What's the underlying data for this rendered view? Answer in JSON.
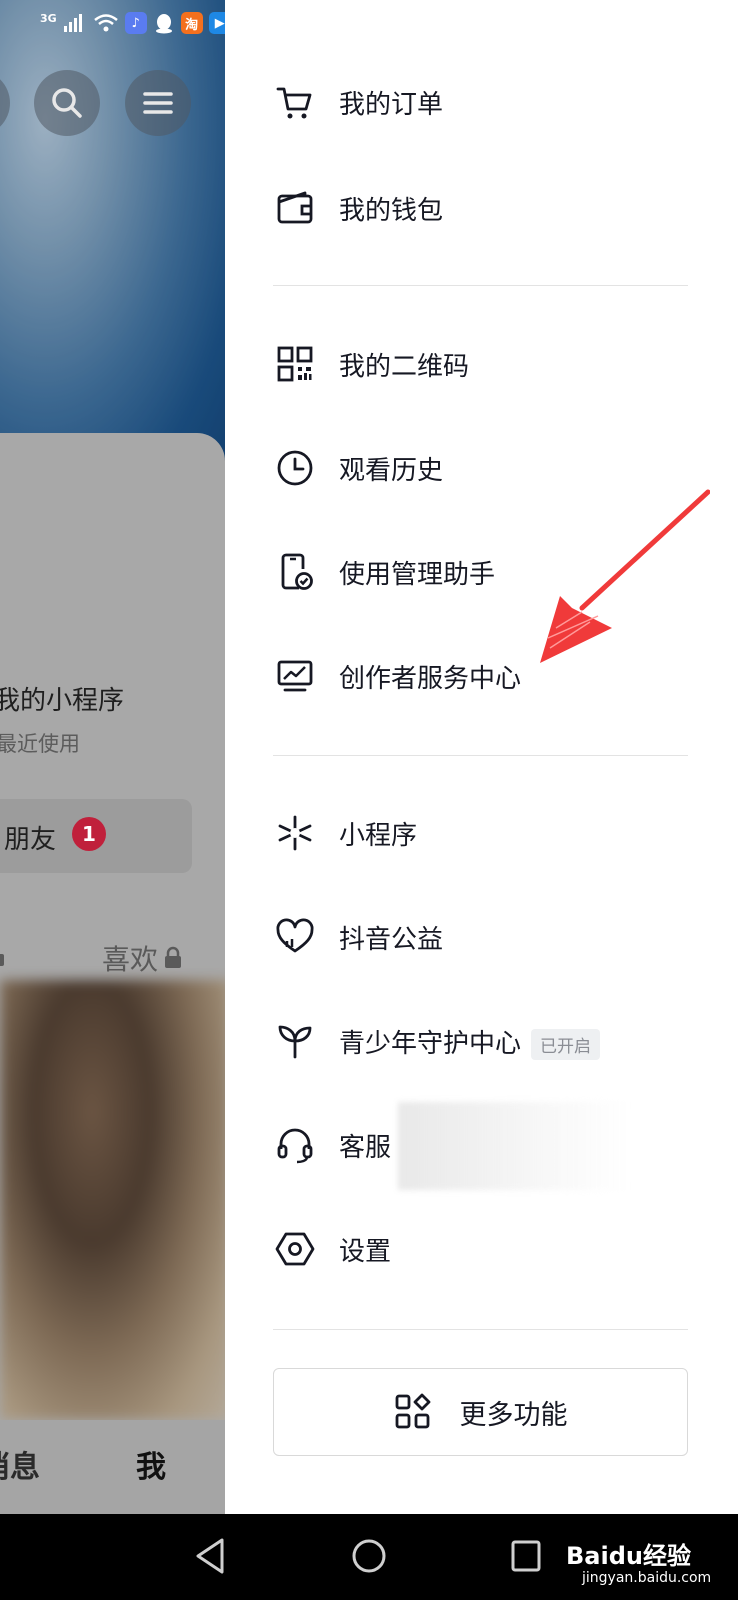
{
  "status_bar": {
    "network": "3G",
    "app_icons": [
      "music-app-icon",
      "qq-icon",
      "taobao-icon",
      "video-app-icon"
    ],
    "taobao_char": "淘"
  },
  "background_page": {
    "mini_programs": {
      "title": "我的小程序",
      "subtitle": "最近使用"
    },
    "friends": {
      "label": "朋友",
      "badge": "1"
    },
    "likes_tab": "喜欢",
    "bottom_tabs": {
      "messages": "消息",
      "me": "我"
    }
  },
  "drawer": {
    "group1": [
      {
        "label": "我的订单",
        "icon": "cart-icon"
      },
      {
        "label": "我的钱包",
        "icon": "wallet-icon"
      }
    ],
    "group2": [
      {
        "label": "我的二维码",
        "icon": "qrcode-icon"
      },
      {
        "label": "观看历史",
        "icon": "clock-icon"
      },
      {
        "label": "使用管理助手",
        "icon": "phone-check-icon"
      },
      {
        "label": "创作者服务中心",
        "icon": "chart-monitor-icon"
      }
    ],
    "group3": [
      {
        "label": "小程序",
        "icon": "mini-program-icon"
      },
      {
        "label": "抖音公益",
        "icon": "charity-heart-icon"
      },
      {
        "label": "青少年守护中心",
        "icon": "sprout-icon",
        "tag": "已开启"
      },
      {
        "label": "客服",
        "icon": "headset-icon"
      },
      {
        "label": "设置",
        "icon": "settings-hex-icon"
      }
    ],
    "more_button": {
      "label": "更多功能",
      "icon": "apps-grid-icon"
    }
  },
  "nav_bar": {
    "watermark": "Baidu经验",
    "watermark_sub": "jingyan.baidu.com"
  },
  "colors": {
    "badge": "#c0203b",
    "annotation_arrow": "#f03a3a",
    "text_primary": "#161823"
  }
}
